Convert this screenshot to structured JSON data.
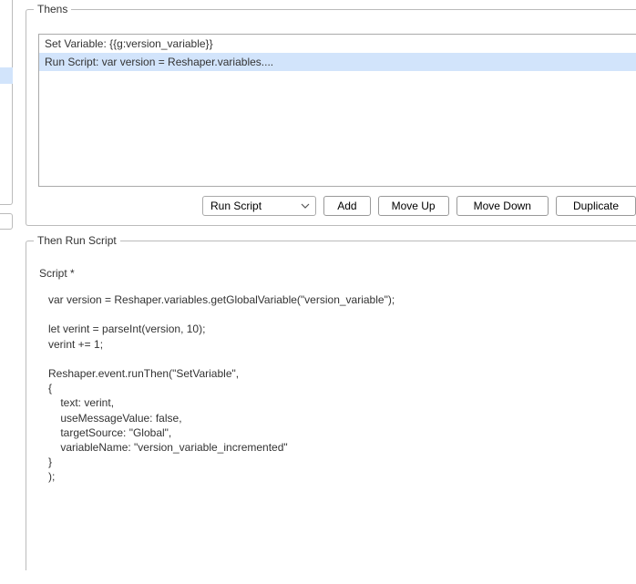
{
  "thens": {
    "legend": "Thens",
    "items": [
      {
        "label": "Set Variable: {{g:version_variable}}"
      },
      {
        "label": "Run Script: var version = Reshaper.variables...."
      }
    ],
    "selected_index": 1
  },
  "controls": {
    "action_options": [
      "Run Script"
    ],
    "action_selected": "Run Script",
    "add_label": "Add",
    "move_up_label": "Move Up",
    "move_down_label": "Move Down",
    "duplicate_label": "Duplicate"
  },
  "detail": {
    "legend": "Then Run Script",
    "script_label": "Script *",
    "script_text": "var version = Reshaper.variables.getGlobalVariable(\"version_variable\");\n\nlet verint = parseInt(version, 10);\nverint += 1;\n\nReshaper.event.runThen(\"SetVariable\",\n{\n    text: verint,\n    useMessageValue: false,\n    targetSource: \"Global\",\n    variableName: \"version_variable_incremented\"\n}\n);"
  }
}
